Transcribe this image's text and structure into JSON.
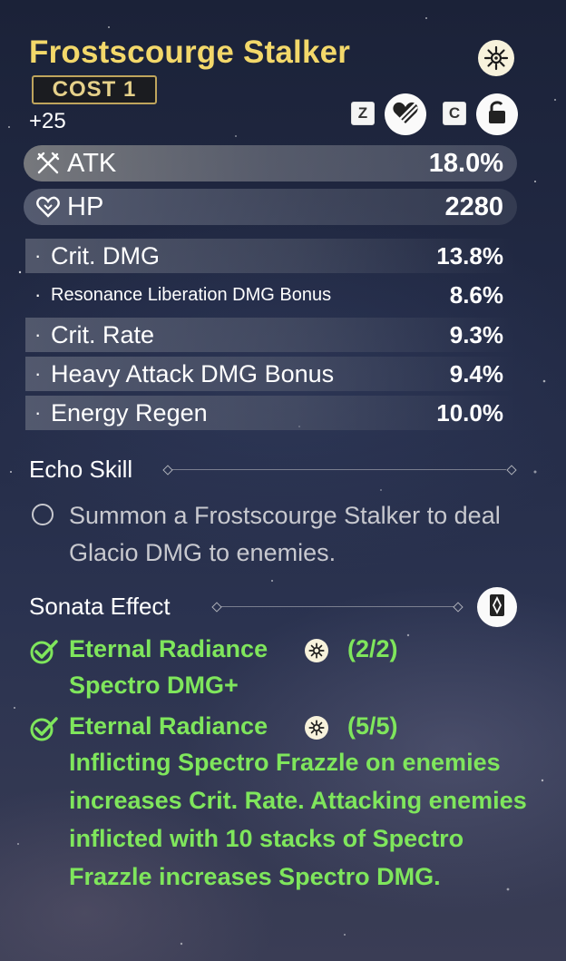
{
  "echo": {
    "name": "Frostscourge Stalker",
    "cost": "COST   1",
    "level": "+25",
    "set_icon": "spectro-sun-icon"
  },
  "controls": {
    "discard_key": "Z",
    "lock_key": "C",
    "discard_icon": "discard-heart-icon",
    "lock_icon": "lock-icon"
  },
  "main_stats": [
    {
      "icon": "crossed-swords-icon",
      "label": "ATK",
      "value": "18.0%"
    },
    {
      "icon": "heart-icon",
      "label": "HP",
      "value": "2280"
    }
  ],
  "sub_stats": [
    {
      "label": "Crit. DMG",
      "value": "13.8%"
    },
    {
      "label": "Resonance Liberation DMG Bonus",
      "value": "8.6%"
    },
    {
      "label": "Crit. Rate",
      "value": "9.3%"
    },
    {
      "label": "Heavy Attack DMG Bonus",
      "value": "9.4%"
    },
    {
      "label": "Energy Regen",
      "value": "10.0%"
    }
  ],
  "echo_skill": {
    "title": "Echo Skill",
    "text": "Summon a Frostscourge Stalker to deal Glacio DMG to enemies."
  },
  "sonata": {
    "title": "Sonata Effect",
    "effects": [
      {
        "name": "Eternal Radiance",
        "count": "(2/2)",
        "desc": "Spectro DMG+"
      },
      {
        "name": "Eternal Radiance",
        "count": "(5/5)",
        "desc": "Inflicting Spectro Frazzle on enemies increases Crit. Rate. Attacking enemies inflicted with 10 stacks of Spectro Frazzle increases Spectro DMG."
      }
    ]
  },
  "colors": {
    "title": "#f3d86a",
    "effect_active": "#7fe65c",
    "cost_border": "#bfa55d"
  }
}
